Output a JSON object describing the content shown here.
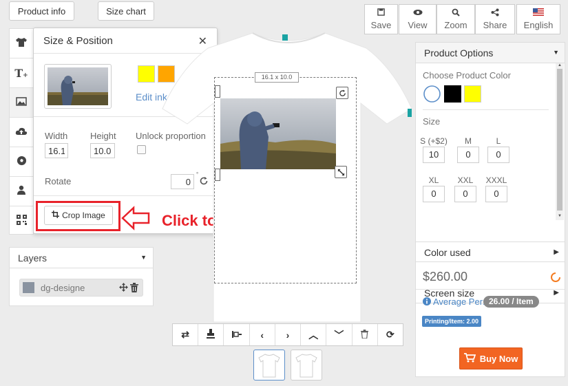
{
  "top": {
    "product_info": "Product info",
    "size_chart": "Size chart",
    "actions": [
      {
        "label": "Save",
        "icon": "floppy-icon"
      },
      {
        "label": "View",
        "icon": "eye-icon"
      },
      {
        "label": "Zoom",
        "icon": "search-icon"
      },
      {
        "label": "Share",
        "icon": "share-icon"
      },
      {
        "label": "English",
        "icon": "us-flag-icon"
      }
    ]
  },
  "sidebar": {
    "tools": [
      "tshirt-icon",
      "text-icon",
      "image-icon",
      "upload-cloud-icon",
      "soccer-ball-icon",
      "user-icon",
      "qrcode-icon"
    ]
  },
  "popup": {
    "title": "Size & Position",
    "ink_colors": [
      "#ffff00",
      "#ffa500"
    ],
    "edit_ink": "Edit ink colors",
    "width_label": "Width",
    "width_value": "16.1",
    "height_label": "Height",
    "height_value": "10.0",
    "unlock_label": "Unlock proportion",
    "rotate_label": "Rotate",
    "rotate_value": "0",
    "crop_label": "Crop Image"
  },
  "annotation": {
    "text": "Click to crop image",
    "color": "#e8222a"
  },
  "layers": {
    "title": "Layers",
    "items": [
      {
        "name": "dg-designe"
      }
    ]
  },
  "canvas": {
    "size_badge": "16.1 x 10.0"
  },
  "product": {
    "options_title": "Product Options",
    "choose_color": "Choose Product Color",
    "colors": [
      "#ffffff",
      "#000000",
      "#ffff00"
    ],
    "size_title": "Size",
    "sizes": [
      {
        "label": "S (+$2)",
        "qty": "10"
      },
      {
        "label": "M",
        "qty": "0"
      },
      {
        "label": "L",
        "qty": "0"
      },
      {
        "label": "XL",
        "qty": "0"
      },
      {
        "label": "XXL",
        "qty": "0"
      },
      {
        "label": "XXXL",
        "qty": "0"
      }
    ],
    "color_used": "Color used",
    "screen_size": "Screen size",
    "price": "$260.00",
    "average_label": "Average Per:",
    "average_value": "26.00 / Item",
    "printing": "Printing/Item: 2.00",
    "buy_now": "Buy Now"
  }
}
